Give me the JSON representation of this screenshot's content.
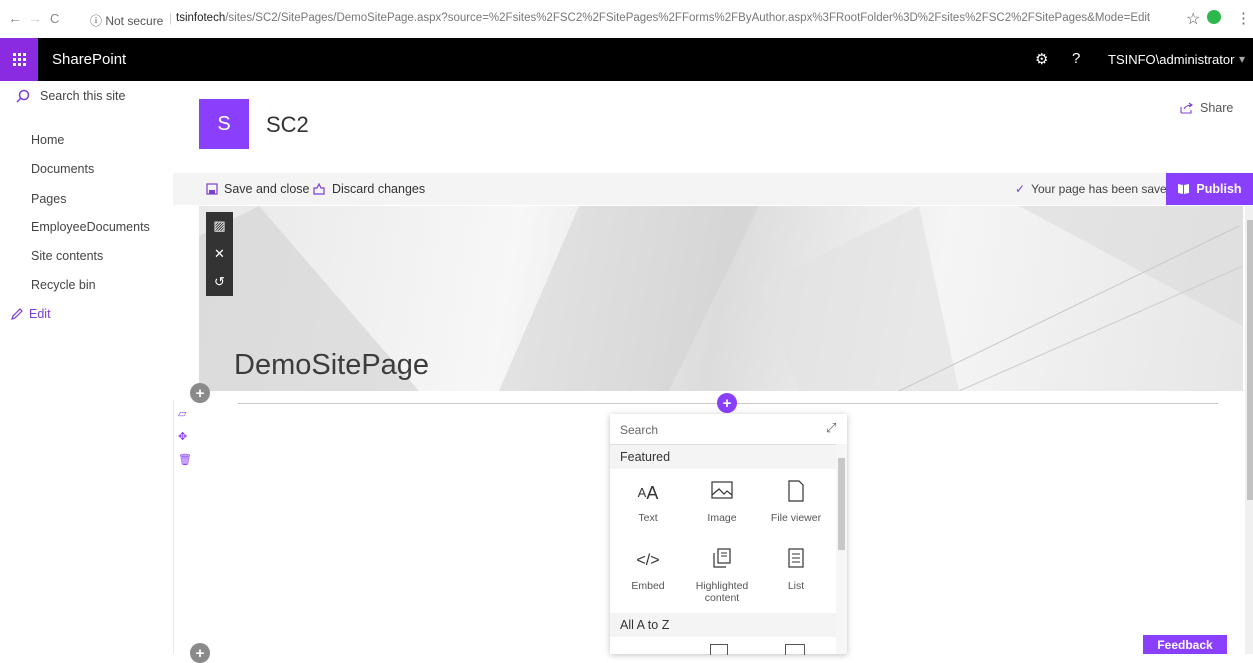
{
  "browser": {
    "nav_back": "←",
    "nav_forward": "→",
    "nav_reload": "C",
    "not_secure": "ⓘ Not secure",
    "url_host": "tsinfotech",
    "url_path": "/sites/SC2/SitePages/DemoSitePage.aspx?source=%2Fsites%2FSC2%2FSitePages%2FForms%2FByAuthor.aspx%3FRootFolder%3D%2Fsites%2FSC2%2FSitePages&Mode=Edit",
    "star": "☆",
    "menu": "⋮"
  },
  "suite": {
    "brand": "SharePoint",
    "settings_glyph": "⚙",
    "help_glyph": "?",
    "user": "TSINFO\\administrator",
    "caret": "▾"
  },
  "leftnav": {
    "search_placeholder": "Search this site",
    "items": [
      {
        "label": "Home"
      },
      {
        "label": "Documents"
      },
      {
        "label": "Pages"
      },
      {
        "label": "EmployeeDocuments"
      },
      {
        "label": "Site contents"
      },
      {
        "label": "Recycle bin"
      }
    ],
    "edit_label": "Edit"
  },
  "header": {
    "logo_letter": "S",
    "site_title": "SC2",
    "share_label": "Share"
  },
  "commandbar": {
    "save_close": "Save and close",
    "discard": "Discard changes",
    "saved_status": "Your page has been saved",
    "publish": "Publish"
  },
  "banner": {
    "page_title": "DemoSitePage"
  },
  "toolbox": {
    "search_placeholder": "Search",
    "featured_label": "Featured",
    "all_label": "All A to Z",
    "tools": [
      {
        "label": "Text",
        "icon": "text-icon",
        "glyph": "AA"
      },
      {
        "label": "Image",
        "icon": "image-icon",
        "glyph": "▨"
      },
      {
        "label": "File viewer",
        "icon": "file-icon",
        "glyph": "▯"
      },
      {
        "label": "Embed",
        "icon": "embed-icon",
        "glyph": "</>"
      },
      {
        "label": "Highlighted content",
        "icon": "highlighted-content-icon",
        "glyph": "❐"
      },
      {
        "label": "List",
        "icon": "list-icon",
        "glyph": "☰"
      }
    ]
  },
  "feedback_label": "Feedback",
  "colors": {
    "accent": "#8a3ffc",
    "suite_bar": "#000000",
    "waffle": "#8a2be2"
  }
}
